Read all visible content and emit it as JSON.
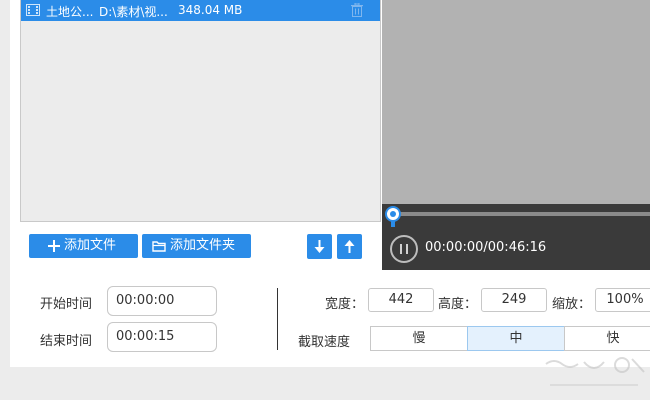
{
  "file_list": {
    "items": [
      {
        "name": "土地公...",
        "path": "D:\\素材\\视...",
        "size": "348.04 MB",
        "selected": true,
        "icon": "film-icon"
      }
    ]
  },
  "toolbar": {
    "add_file_label": "添加文件",
    "add_folder_label": "添加文件夹",
    "move_down_icon": "arrow-down-icon",
    "move_up_icon": "arrow-up-icon"
  },
  "player": {
    "time_display": "00:00:00/00:46:16",
    "progress": 0,
    "state_icon": "pause-icon"
  },
  "settings": {
    "start_time_label": "开始时间",
    "start_time_value": "00:00:00",
    "end_time_label": "结束时间",
    "end_time_value": "00:00:15",
    "width_label": "宽度：",
    "width_value": "442",
    "height_label": "高度：",
    "height_value": "249",
    "scale_label": "缩放：",
    "scale_value": "100%",
    "speed_label": "截取速度",
    "speed_options": [
      "慢",
      "中",
      "快"
    ],
    "speed_selected": "中"
  },
  "colors": {
    "accent": "#2b8ce8",
    "selection": "#2b8ce8",
    "player_bg": "#3a3a3a",
    "preview_bg": "#b2b2b2",
    "segment_active": "#e4f1fd"
  }
}
